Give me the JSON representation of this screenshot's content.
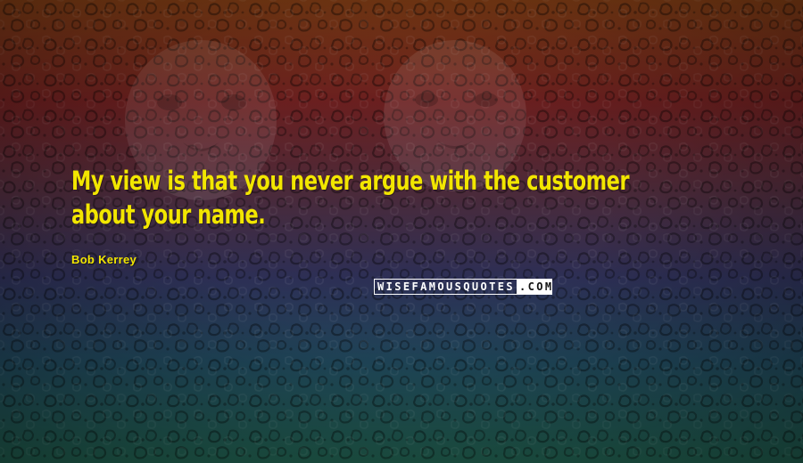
{
  "quote": {
    "text": "My view is that you never argue with the customer about your name."
  },
  "author": {
    "name": "Bob Kerrey"
  },
  "watermark": {
    "part_a": "WISEFAMOUSQUOTES",
    "part_b": ".COM"
  },
  "colors": {
    "text": "#f2e600",
    "bg_top": "#7a3a14",
    "bg_mid": "#2d2f55",
    "bg_bottom": "#1f5a4a"
  },
  "icons": {
    "background": "leopard-pattern-image"
  }
}
